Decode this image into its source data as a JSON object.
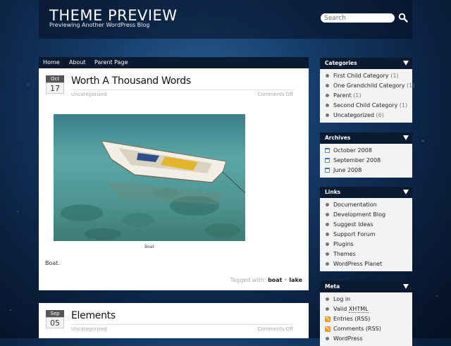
{
  "header": {
    "site_title": "THEME PREVIEW",
    "site_description": "Previewing Another WordPress Blog",
    "search_placeholder": "Search"
  },
  "nav": {
    "items": [
      "Home",
      "About",
      "Parent Page"
    ]
  },
  "posts": [
    {
      "month": "Oct",
      "day": "17",
      "title": "Worth A Thousand Words",
      "category": "Uncategorized",
      "comments": "Comments Off",
      "image_caption": "Boat",
      "excerpt": "Boat.",
      "tags_label": "Tagged with:",
      "tags": [
        "boat",
        "lake"
      ],
      "tag_separator": "•"
    },
    {
      "month": "Sep",
      "day": "05",
      "title": "Elements",
      "category": "Uncategorized",
      "comments": "Comments Off"
    }
  ],
  "sidebar": {
    "categories": {
      "title": "Categories",
      "items": [
        {
          "label": "First Child Category",
          "count": "(1)"
        },
        {
          "label": "One Grandchild Category",
          "count": "(1)"
        },
        {
          "label": "Parent",
          "count": "(1)"
        },
        {
          "label": "Second Child Category",
          "count": "(1)"
        },
        {
          "label": "Uncategorized",
          "count": "(6)"
        }
      ]
    },
    "archives": {
      "title": "Archives",
      "items": [
        "October 2008",
        "September 2008",
        "June 2008"
      ]
    },
    "links": {
      "title": "Links",
      "items": [
        "Documentation",
        "Development Blog",
        "Suggest Ideas",
        "Support Forum",
        "Plugins",
        "Themes",
        "WordPress Planet"
      ]
    },
    "meta": {
      "title": "Meta",
      "log_in": "Log in",
      "valid_prefix": "Valid",
      "xhtml": "XHTML",
      "entries_rss": "Entries (RSS)",
      "comments_rss": "Comments (RSS)",
      "wordpress": "WordPress"
    }
  },
  "icons": [
    "search-icon",
    "collapse-arrow-icon",
    "bullet-icon",
    "calendar-icon",
    "rss-icon"
  ]
}
